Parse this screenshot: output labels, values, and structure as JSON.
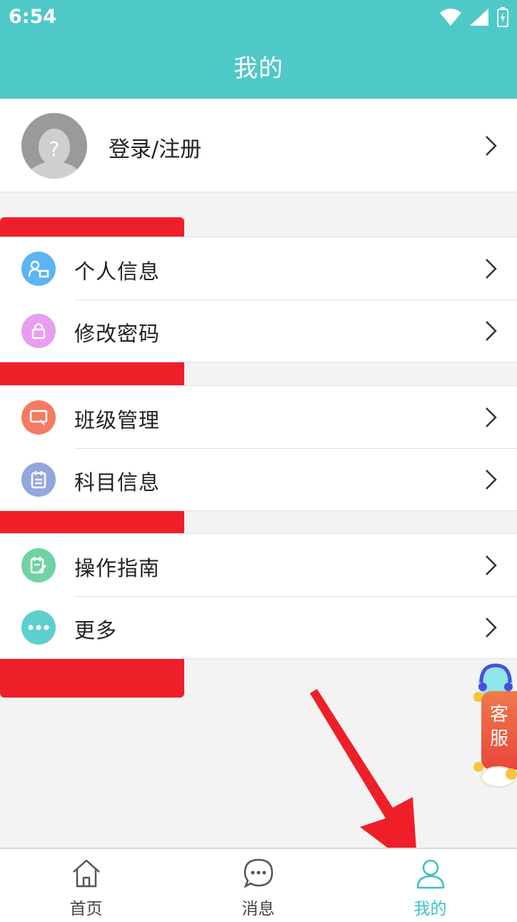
{
  "status_bar": {
    "time": "6:54"
  },
  "header": {
    "title": "我的"
  },
  "profile": {
    "label": "登录/注册"
  },
  "sections": [
    {
      "items": [
        {
          "label": "个人信息",
          "icon": "person-card-icon",
          "color": "#5db4f2"
        },
        {
          "label": "修改密码",
          "icon": "lock-icon",
          "color": "#e79ef0"
        }
      ]
    },
    {
      "items": [
        {
          "label": "班级管理",
          "icon": "class-icon",
          "color": "#f47b63"
        },
        {
          "label": "科目信息",
          "icon": "clipboard-icon",
          "color": "#94a6e0"
        }
      ]
    },
    {
      "items": [
        {
          "label": "操作指南",
          "icon": "guide-icon",
          "color": "#6fd3a3"
        },
        {
          "label": "更多",
          "icon": "more-dots-icon",
          "color": "#5dcfcf"
        }
      ]
    }
  ],
  "support": {
    "line1": "客",
    "line2": "服"
  },
  "tabs": [
    {
      "label": "首页",
      "icon": "home-icon",
      "active": false
    },
    {
      "label": "消息",
      "icon": "chat-bubble-icon",
      "active": false
    },
    {
      "label": "我的",
      "icon": "user-icon",
      "active": true
    }
  ],
  "colors": {
    "primary": "#4fc8c8",
    "annotation": "#ef1f2a"
  }
}
